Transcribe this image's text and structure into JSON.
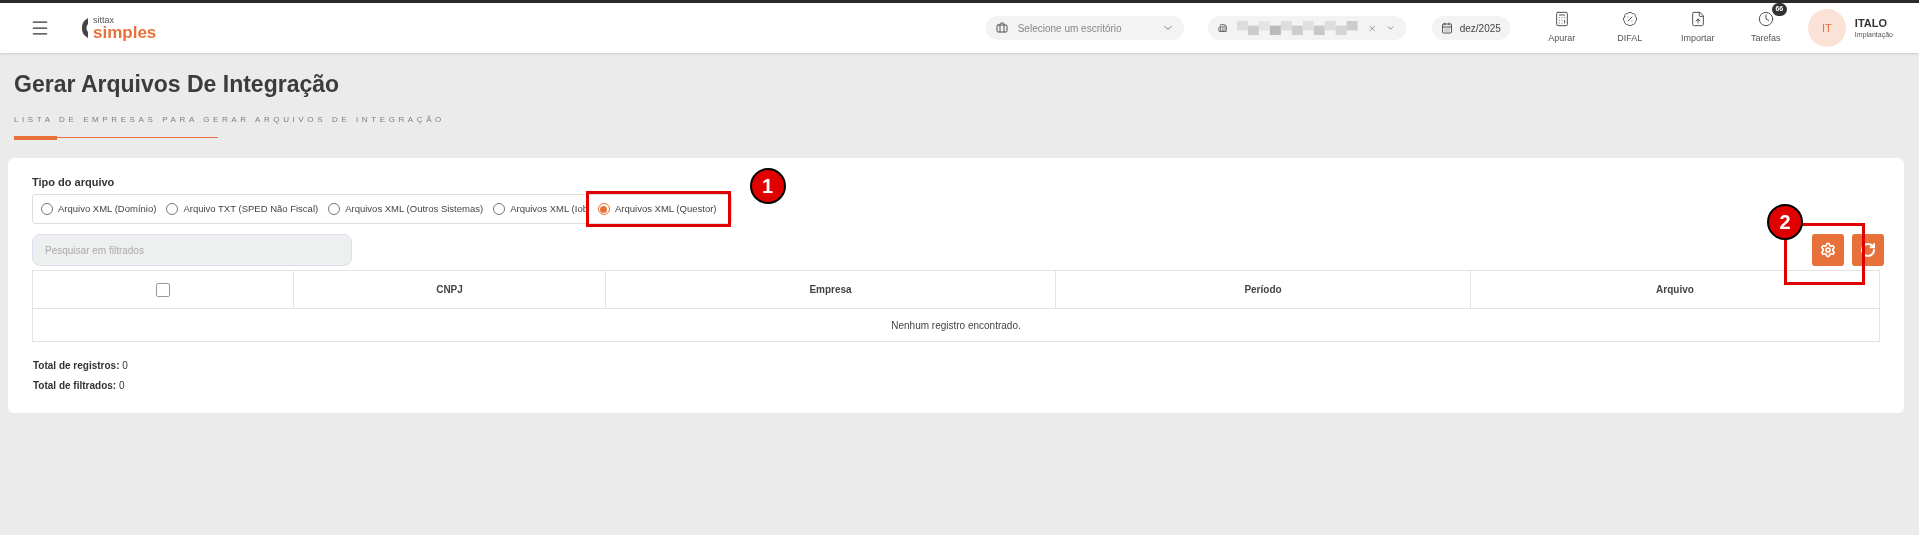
{
  "header": {
    "logo": {
      "top": "sittax",
      "main": "simples"
    },
    "office_select": {
      "placeholder": "Selecione um escritório"
    },
    "company_select": {
      "kind": "redacted"
    },
    "date": "dez/2025",
    "actions": [
      {
        "kind": "calculator",
        "label": "Apurar"
      },
      {
        "kind": "percent",
        "label": "DIFAL"
      },
      {
        "kind": "upload",
        "label": "Importar"
      },
      {
        "kind": "clock",
        "label": "Tarefas",
        "badge": "66"
      }
    ],
    "user": {
      "initials": "IT",
      "name": "ITALO",
      "role": "Implantação"
    }
  },
  "page": {
    "title": "Gerar Arquivos De Integração",
    "subtitle": "LISTA DE EMPRESAS PARA GERAR ARQUIVOS DE INTEGRAÇÃO"
  },
  "file_type": {
    "label": "Tipo do arquivo",
    "options": [
      {
        "label": "Arquivo XML (Domínio)",
        "selected": false
      },
      {
        "label": "Arquivo TXT (SPED Não Fiscal)",
        "selected": false
      },
      {
        "label": "Arquivos XML (Outros Sistemas)",
        "selected": false
      },
      {
        "label": "Arquivos XML (Iob",
        "selected": false
      },
      {
        "label": "Arquivos XML (Questor)",
        "selected": true
      }
    ]
  },
  "search": {
    "placeholder": "Pesquisar em filtrados"
  },
  "toolbar": [
    {
      "kind": "settings"
    },
    {
      "kind": "refresh"
    }
  ],
  "table": {
    "select_all": {
      "checked": false
    },
    "columns": [
      "CNPJ",
      "Empresa",
      "Período",
      "Arquivo"
    ],
    "empty_message": "Nenhum registro encontrado."
  },
  "totals": [
    {
      "label": "Total de registros:",
      "value": "0"
    },
    {
      "label": "Total de filtrados:",
      "value": "0"
    }
  ],
  "annotations": [
    {
      "number": "1"
    },
    {
      "number": "2"
    }
  ]
}
